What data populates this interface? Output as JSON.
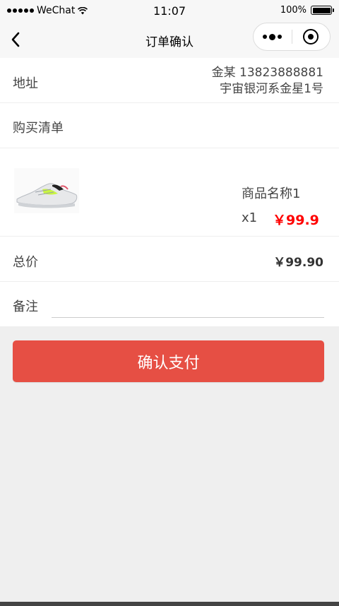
{
  "status_bar": {
    "carrier": "WeChat",
    "time": "11:07",
    "battery": "100%",
    "battery_level": 1.0
  },
  "nav": {
    "title": "订单确认"
  },
  "address": {
    "label": "地址",
    "name_phone": "金某 13823888881",
    "detail": "宇宙银河系金星1号"
  },
  "shopping_list": {
    "label": "购买清单"
  },
  "item": {
    "name": "商品名称1",
    "quantity": "x1",
    "price": "￥99.9"
  },
  "total": {
    "label": "总价",
    "value": "￥99.90"
  },
  "remark": {
    "label": "备注",
    "placeholder": ""
  },
  "pay_button": {
    "label": "确认支付"
  },
  "colors": {
    "accent": "#e64f44",
    "price": "#ff0000",
    "background": "#efefef"
  }
}
